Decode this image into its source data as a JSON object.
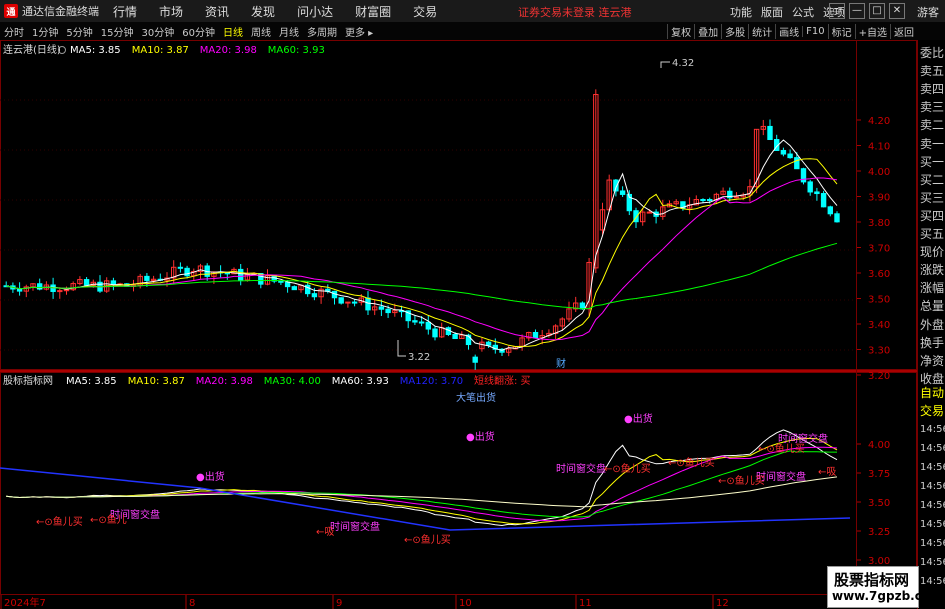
{
  "app": {
    "logo": "通",
    "title": "通达信金融终端",
    "warning": "证券交易未登录 连云港",
    "guest": "游客"
  },
  "menu": [
    "行情",
    "市场",
    "资讯",
    "发现",
    "问小达",
    "财富圈",
    "交易"
  ],
  "right_menu": [
    "功能",
    "版面",
    "公式",
    "选项"
  ],
  "window_buttons": [
    "▭",
    "—",
    "□",
    "✕"
  ],
  "periods": [
    "分时",
    "1分钟",
    "5分钟",
    "15分钟",
    "30分钟",
    "60分钟",
    "日线",
    "周线",
    "月线",
    "多周期",
    "更多 ▸"
  ],
  "active_period": "日线",
  "toolbar": [
    "复权",
    "叠加",
    "多股",
    "统计",
    "画线",
    "F10",
    "标记",
    "+自选",
    "返回"
  ],
  "main_legend": {
    "stock": "连云港(日线)",
    "items": [
      {
        "label": "MA5: 3.85",
        "color": "#ffffff"
      },
      {
        "label": "MA10: 3.87",
        "color": "#ffff00"
      },
      {
        "label": "MA20: 3.98",
        "color": "#ff00ff"
      },
      {
        "label": "MA60: 3.93",
        "color": "#00ff00"
      }
    ]
  },
  "main_axis": [
    "4.20",
    "4.10",
    "4.00",
    "3.90",
    "3.80",
    "3.70",
    "3.60",
    "3.50",
    "3.40",
    "3.30",
    "3.20"
  ],
  "main_annotations": {
    "high": "4.32",
    "low": "3.22",
    "event": "财"
  },
  "ind_legend": {
    "name": "股标指标网",
    "items": [
      {
        "label": "MA5: 3.85",
        "color": "#ffffff"
      },
      {
        "label": "MA10: 3.87",
        "color": "#ffff00"
      },
      {
        "label": "MA20: 3.98",
        "color": "#ff00ff"
      },
      {
        "label": "MA30: 4.00",
        "color": "#00ff00"
      },
      {
        "label": "MA60: 3.93",
        "color": "#ffffff"
      },
      {
        "label": "MA120: 3.70",
        "color": "#2222ff"
      },
      {
        "label": "短线翻涨: 买",
        "color": "#ff2222"
      }
    ]
  },
  "ind_axis": [
    "4.00",
    "3.75",
    "3.50",
    "3.25",
    "3.00"
  ],
  "ind_annotations": {
    "title": "大笔出货",
    "outs": [
      "●出货",
      "●出货",
      "●出货"
    ],
    "times": [
      "时间窗交盘",
      "时间窗交盘",
      "时间窗交盘",
      "时间窗交盘",
      "时间窗交盘"
    ],
    "fish": [
      "←⊙鱼儿买",
      "←⊙鱼儿买",
      "←⊙鱼儿买",
      "←⊙鱼儿买",
      "←⊙鱼儿买",
      "←⊙鱼儿买"
    ],
    "fish_short": "←⊙鱼儿",
    "absorbs": [
      "←吸",
      "←吸"
    ]
  },
  "dates": [
    "2024年7",
    "8",
    "9",
    "10",
    "11",
    "12"
  ],
  "right_panel": [
    "委比",
    "卖五",
    "卖四",
    "卖三",
    "卖二",
    "卖一",
    "买一",
    "买二",
    "买三",
    "买四",
    "买五",
    "现价",
    "涨跌",
    "涨幅",
    "总量",
    "外盘",
    "换手",
    "净资",
    "收盘"
  ],
  "right_panel2": [
    "自动",
    "交易"
  ],
  "right_times": [
    "14:56",
    "14:56",
    "14:56",
    "14:56",
    "14:56",
    "14:56",
    "14:56",
    "14:56",
    "14:56"
  ],
  "watermark": {
    "line1": "股票指标网",
    "line2": "www.7gpzb.com"
  }
}
